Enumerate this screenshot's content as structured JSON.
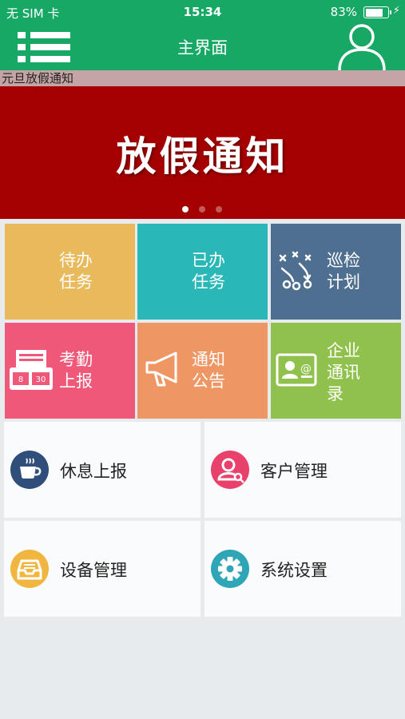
{
  "status_bar": {
    "carrier": "无 SIM 卡",
    "time": "15:34",
    "battery": "83%",
    "battery_level": 0.83
  },
  "nav": {
    "title": "主界面",
    "menu_icon": "menu-list-icon",
    "profile_icon": "user-profile-icon"
  },
  "notice_marquee": "元旦放假通知",
  "banner": {
    "text": "放假通知",
    "slide_count": 3,
    "active_slide": 1,
    "background": "#a50002"
  },
  "tiles": [
    {
      "label": "待办\n任务",
      "color": "#e8ba5b",
      "icon": ""
    },
    {
      "label": "已办\n任务",
      "color": "#2ab7b8",
      "icon": ""
    },
    {
      "label": "巡检\n计划",
      "color": "#4f6f91",
      "icon": "play-strategy-icon"
    },
    {
      "label": "考勤\n上报",
      "color": "#f0587a",
      "icon": "attendance-clock-icon"
    },
    {
      "label": "通知\n公告",
      "color": "#ef9764",
      "icon": "megaphone-icon"
    },
    {
      "label": "企业\n通讯\n录",
      "color": "#8fc14c",
      "icon": "contact-card-icon"
    }
  ],
  "cards": [
    {
      "label": "休息上报",
      "color": "#2f4f7a",
      "icon": "coffee-cup-icon"
    },
    {
      "label": "客户管理",
      "color": "#e8416b",
      "icon": "customer-search-icon"
    },
    {
      "label": "设备管理",
      "color": "#f0b640",
      "icon": "inbox-tray-icon"
    },
    {
      "label": "系统设置",
      "color": "#2fa6b8",
      "icon": "gear-icon"
    }
  ]
}
